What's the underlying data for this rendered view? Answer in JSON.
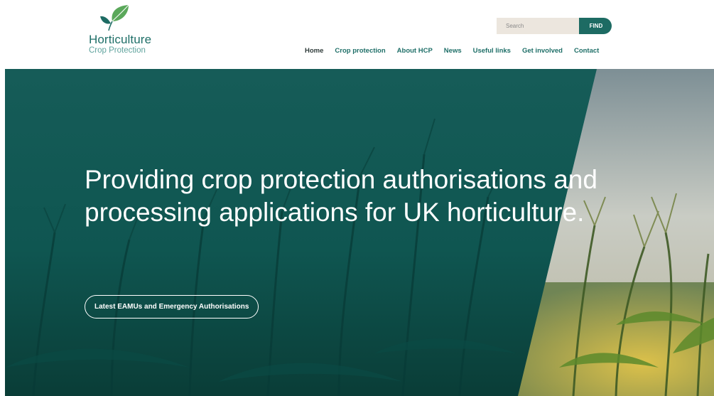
{
  "logo": {
    "line1": "Horticulture",
    "line2": "Crop Protection",
    "icon": "leaf-icon"
  },
  "search": {
    "placeholder": "Search",
    "button_label": "FIND"
  },
  "nav": {
    "items": [
      {
        "label": "Home"
      },
      {
        "label": "Crop protection"
      },
      {
        "label": "About HCP"
      },
      {
        "label": "News"
      },
      {
        "label": "Useful links"
      },
      {
        "label": "Get involved"
      },
      {
        "label": "Contact"
      }
    ]
  },
  "hero": {
    "title": "Providing crop protection authorisations and processing applications for UK horticulture.",
    "button_label": "Latest EAMUs and Emergency Authorisations"
  },
  "colors": {
    "brand_teal": "#1d6b63",
    "hero_overlay": "#0f5a55",
    "search_bg": "#ece6de"
  }
}
